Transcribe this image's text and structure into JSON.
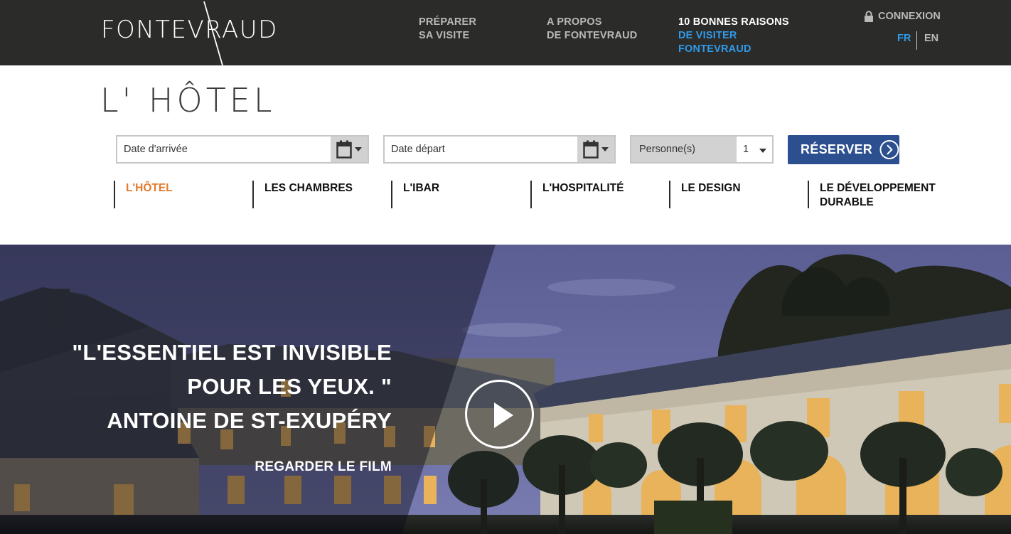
{
  "brand": {
    "logo_text": "FONTEVRAUD"
  },
  "top_nav": {
    "items": [
      {
        "line1": "PRÉPARER",
        "line2": "SA VISITE"
      },
      {
        "line1": "A PROPOS",
        "line2": "DE FONTEVRAUD"
      },
      {
        "line1": "10 BONNES RAISONS",
        "line2": "DE VISITER",
        "line3": "FONTEVRAUD"
      }
    ],
    "login_label": "CONNEXION",
    "languages": [
      "FR",
      "EN"
    ],
    "active_language": "FR"
  },
  "page": {
    "title": "L' HÔTEL"
  },
  "booking": {
    "arrival_placeholder": "Date d'arrivée",
    "departure_placeholder": "Date départ",
    "persons_label": "Personne(s)",
    "persons_value": "1",
    "reserve_label": "RÉSERVER"
  },
  "sub_nav": {
    "active": "L'HÔTEL",
    "items": [
      "L'HÔTEL",
      "LES CHAMBRES",
      "L'IBAR",
      "L'HOSPITALITÉ",
      "LE DESIGN",
      "LE DÉVELOPPEMENT DURABLE"
    ]
  },
  "hero": {
    "quote_lines": [
      "\"L'ESSENTIEL EST INVISIBLE",
      "POUR LES YEUX. \"",
      "ANTOINE DE ST-EXUPÉRY"
    ],
    "watch_label": "REGARDER LE FILM"
  },
  "colors": {
    "topbar_bg": "#2b2b2a",
    "accent_blue": "#2f9ae8",
    "active_orange": "#e27a2e",
    "reserve_button": "#2b4f8f"
  },
  "icons": [
    "lock-icon",
    "calendar-icon",
    "caret-down-icon",
    "chevron-right-circle-icon",
    "play-icon"
  ]
}
